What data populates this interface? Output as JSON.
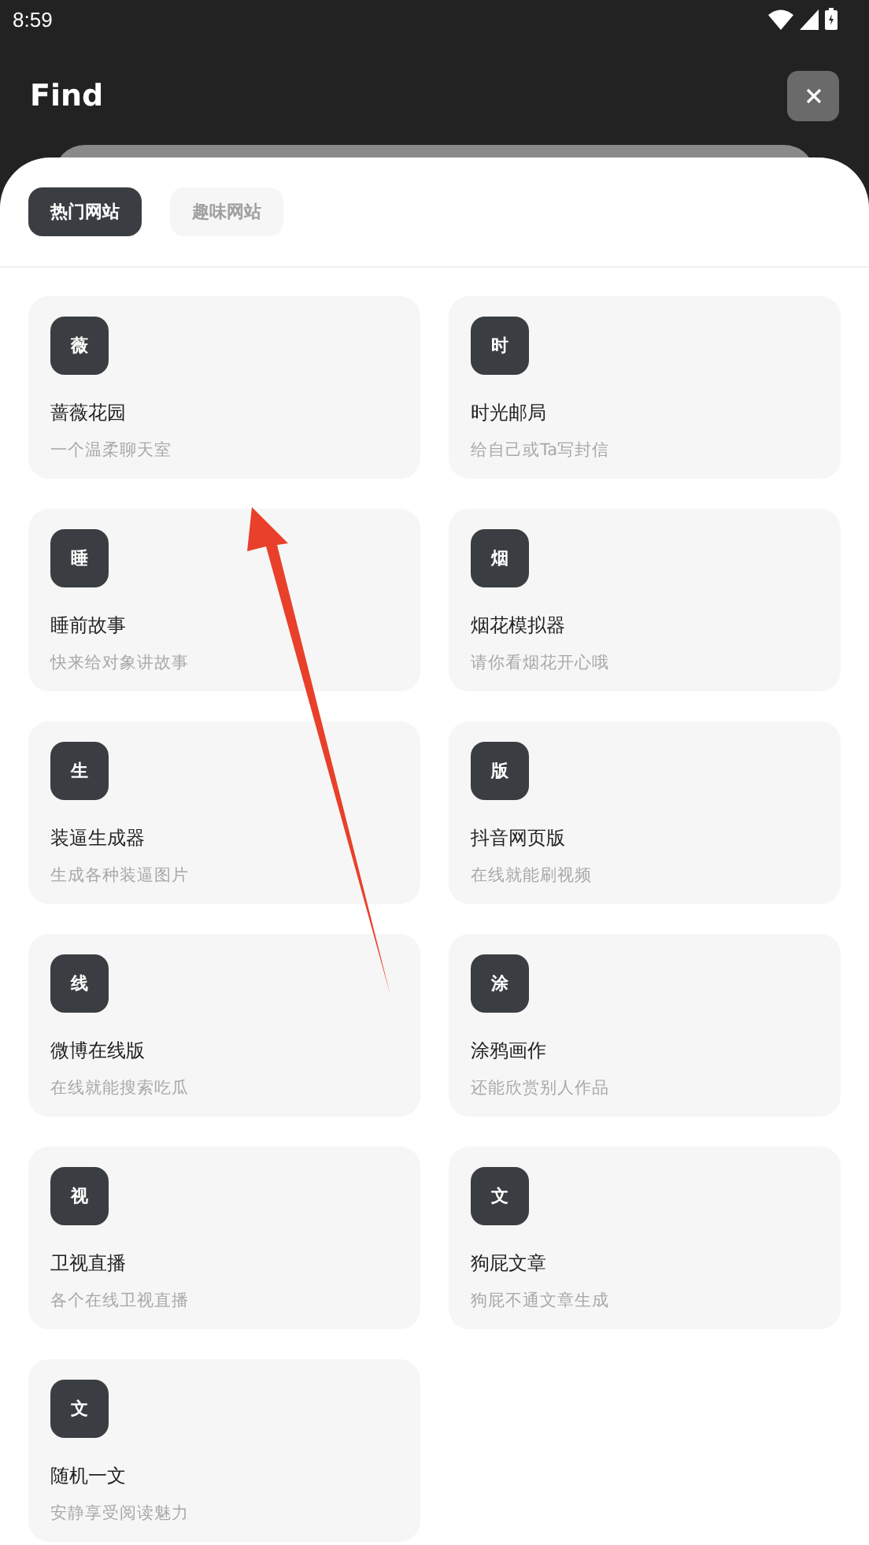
{
  "status_bar": {
    "time": "8:59"
  },
  "header": {
    "title": "Find"
  },
  "tabs": [
    {
      "label": "热门网站",
      "selected": true
    },
    {
      "label": "趣味网站",
      "selected": false
    }
  ],
  "sites": [
    {
      "badge": "薇",
      "title": "蔷薇花园",
      "subtitle": "一个温柔聊天室"
    },
    {
      "badge": "时",
      "title": "时光邮局",
      "subtitle": "给自己或Ta写封信"
    },
    {
      "badge": "睡",
      "title": "睡前故事",
      "subtitle": "快来给对象讲故事"
    },
    {
      "badge": "烟",
      "title": "烟花模拟器",
      "subtitle": "请你看烟花开心哦"
    },
    {
      "badge": "生",
      "title": "装逼生成器",
      "subtitle": "生成各种装逼图片"
    },
    {
      "badge": "版",
      "title": "抖音网页版",
      "subtitle": "在线就能刷视频"
    },
    {
      "badge": "线",
      "title": "微博在线版",
      "subtitle": "在线就能搜索吃瓜"
    },
    {
      "badge": "涂",
      "title": "涂鸦画作",
      "subtitle": "还能欣赏别人作品"
    },
    {
      "badge": "视",
      "title": "卫视直播",
      "subtitle": "各个在线卫视直播"
    },
    {
      "badge": "文",
      "title": "狗屁文章",
      "subtitle": "狗屁不通文章生成"
    },
    {
      "badge": "文",
      "title": "随机一文",
      "subtitle": "安静享受阅读魅力"
    }
  ]
}
